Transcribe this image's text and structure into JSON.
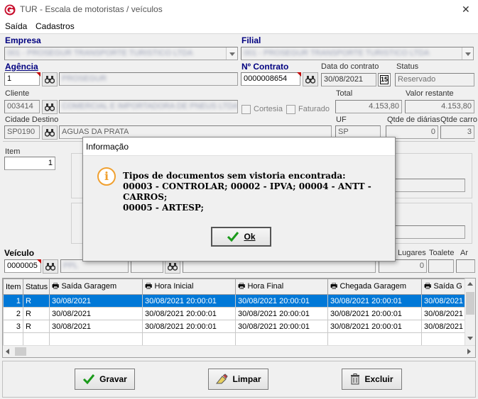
{
  "window": {
    "title": "TUR - Escala de motoristas / veículos",
    "close_symbol": "✕"
  },
  "menu": {
    "items": [
      "Saída",
      "Cadastros"
    ]
  },
  "form": {
    "empresa_label": "Empresa",
    "empresa_value": "001 - PROSEGUR TRANSPORTE TURISTICO LTDA",
    "filial_label": "Filial",
    "filial_value": "001 - PROSEGUR TRANSPORTE TURISTICO LTDA",
    "agencia_label": "Agência",
    "agencia_value": "1",
    "agencia_name": "PROSEGUR",
    "contrato_label": "Nº Contrato",
    "contrato_value": "0000008654",
    "data_contrato_label": "Data do contrato",
    "data_contrato_value": "30/08/2021",
    "calendar_text": "15",
    "status_label": "Status",
    "status_value": "Reservado",
    "cliente_label": "Cliente",
    "cliente_code": "003414",
    "cliente_name": "COMERCIAL E IMPORTADORA DE PNEUS LTDA",
    "cortesia_label": "Cortesia",
    "faturado_label": "Faturado",
    "total_label": "Total",
    "total_value": "4.153,80",
    "valor_restante_label": "Valor restante",
    "valor_restante_value": "4.153,80",
    "cidade_label": "Cidade Destino",
    "cidade_code": "SP0190",
    "cidade_name": "AGUAS DA PRATA",
    "uf_label": "UF",
    "uf_value": "SP",
    "qtde_diarias_label": "Qtde de diárias",
    "qtde_diarias_value": "0",
    "qtde_carros_label": "Qtde carro",
    "qtde_carros_value": "3",
    "item_label": "Item",
    "item_value": "1",
    "veiculo_label": "Veículo",
    "veiculo_value": "0000005",
    "veiculo_name": "PPL",
    "lugares_label": "Lugares",
    "lugares_value": "0",
    "toalete_label": "Toalete",
    "ar_label": "Ar"
  },
  "grid": {
    "columns": [
      "Item",
      "Status",
      "Saída Garagem",
      "Hora Inicial",
      "Hora Final",
      "Chegada Garagem",
      "Saída G"
    ],
    "rows": [
      [
        "1",
        "R",
        "30/08/2021",
        "30/08/2021 20:00:01",
        "30/08/2021 20:00:01",
        "30/08/2021 20:00:01",
        "30/08/2021"
      ],
      [
        "2",
        "R",
        "30/08/2021",
        "30/08/2021 20:00:01",
        "30/08/2021 20:00:01",
        "30/08/2021 20:00:01",
        "30/08/2021"
      ],
      [
        "3",
        "R",
        "30/08/2021",
        "30/08/2021 20:00:01",
        "30/08/2021 20:00:01",
        "30/08/2021 20:00:01",
        "30/08/2021"
      ]
    ]
  },
  "buttons": {
    "gravar": "Gravar",
    "limpar": "Limpar",
    "excluir": "Excluir"
  },
  "dialog": {
    "title": "Informação",
    "message_line1": "Tipos de documentos sem vistoria encontrada:",
    "message_line2": "00003 - CONTROLAR; 00002 - IPVA; 00004 - ANTT - CARROS;",
    "message_line3": "00005 - ARTESP;",
    "ok_label": "Ok",
    "icon_symbol": "i"
  },
  "colors": {
    "accent_label": "#000080",
    "selection": "#0078d7",
    "app_icon": "#c8102e",
    "info_icon": "#f0a030"
  }
}
